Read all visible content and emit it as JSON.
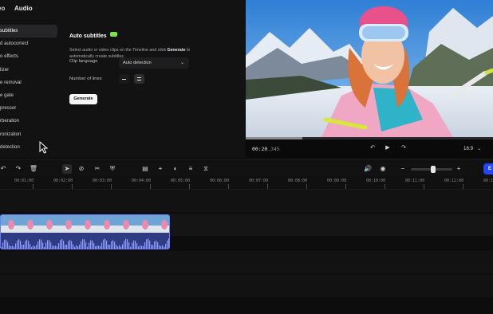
{
  "panel": {
    "tabs": [
      "eo",
      "Audio"
    ],
    "list_items": [
      "subtitles",
      "d autocorrect",
      "o effects",
      "lizer",
      "e removal",
      "e gate",
      "pressor",
      "rberation",
      "ronization",
      "detection"
    ],
    "active_index": 0
  },
  "settings": {
    "title": "Auto subtitles",
    "desc_1": "Select audio or video clips on the Timeline and click ",
    "desc_bold": "Generate",
    "desc_2": " to automatically create subtitles",
    "clip_language_label": "Clip language",
    "clip_language_value": "Auto detection",
    "lines_label": "Number of lines",
    "generate_label": "Generate"
  },
  "preview": {
    "timecode_main": "00:20",
    "timecode_ms": ".345",
    "aspect_ratio": "16:9",
    "progress": 0.23
  },
  "ruler": {
    "labels": [
      "00:01:00",
      "00:02:00",
      "00:03:00",
      "00:04:00",
      "00:05:00",
      "00:06:00",
      "00:07:00",
      "00:08:00",
      "00:09:00",
      "00:10:00",
      "00:11:00",
      "00:12:00",
      "00:1"
    ]
  },
  "toolbar": {
    "zoom": 0.55,
    "export_label": "E"
  },
  "colors": {
    "accent": "#2046ff",
    "clip_border": "#6b7cff",
    "ai_badge": "#7ee24d"
  }
}
